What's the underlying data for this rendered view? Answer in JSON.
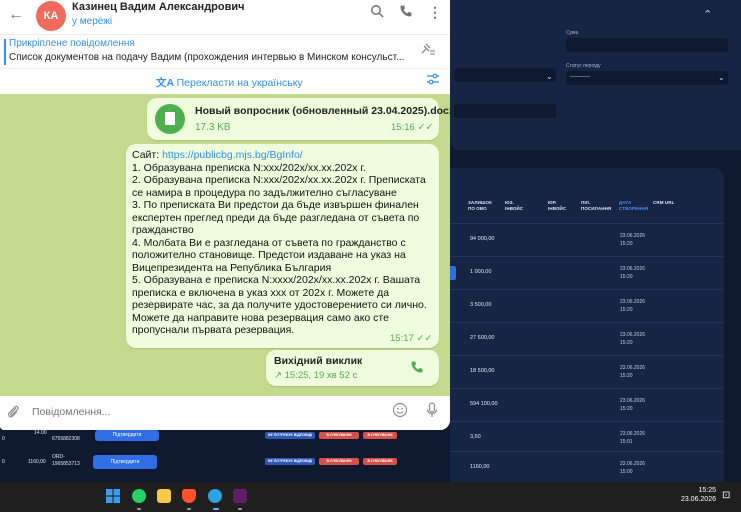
{
  "telegram": {
    "contact": {
      "initials": "КА",
      "name": "Казинец Вадим Александрович",
      "status": "у мережі"
    },
    "pinned": {
      "title": "Прикріплене повідомлення",
      "text": "Список документов на подачу Вадим (прохождения интервью в Минском консульст..."
    },
    "translate_label": "Перекласти на українську",
    "file_message": {
      "name": "Новый вопросник (обновленный 23.04.2025).docx",
      "size": "17.3 KB",
      "time": "15:16"
    },
    "text_message": {
      "link_prefix": "Сайт: ",
      "link": "https://publicbg.mjs.bg/BgInfo/",
      "lines": [
        "1. Образувана преписка N:xxx/202x/xx.xx.202x г.",
        "2. Образувана преписка N:xxx/202x/xx.xx.202x г. Преписката се намира в процедура по задължително съгласуване",
        "3. По преписката Ви предстои да бъде извършен финален експертен преглед преди да бъде разгледана от съвета по гражданство",
        "4. Молбата Ви е разгледана от съвета по гражданство с положително становище. Предстои издаване на указ на Вицепрезидента на Република България",
        "5. Образувана е преписка N:xxxx/202x/xx.xx.202x г. Вашата преписка е включена в указ xxx от 202x г. Можете да резервирате час, за да получите удостоверението си лично. Можете да направите нова резервация само ако сте пропуснали първата резервация."
      ],
      "time": "15:17"
    },
    "call_message": {
      "title": "Вихідний виклик",
      "meta": "15:25, 19 хв 52 с"
    },
    "composer_placeholder": "Повідомлення..."
  },
  "crm": {
    "filter": {
      "sum_label": "Сума",
      "status_label": "Статус періоду",
      "status_value": "----------"
    },
    "table": {
      "headers": [
        "ЗАЛИШОК ПО ОВО",
        "ЮЗ. ІНВОЙС",
        "ЮР. ІНВОЙС",
        "ПІЛ. ПОСИЛАННЯ",
        "ДАТА СТВОРЕННЯ",
        "CRM URL"
      ],
      "rows": [
        {
          "sum": "94 000,00",
          "date": "23.06.2026",
          "time": "15:20"
        },
        {
          "sum": "1 000,00",
          "date": "23.06.2026",
          "time": "15:20"
        },
        {
          "sum": "3 500,00",
          "date": "23.06.2026",
          "time": "15:20"
        },
        {
          "sum": "27 600,00",
          "date": "23.06.2026",
          "time": "15:20"
        },
        {
          "sum": "18 500,00",
          "date": "23.06.2026",
          "time": "15:20"
        },
        {
          "sum": "594 100,00",
          "date": "23.06.2026",
          "time": "15:20"
        },
        {
          "sum": "3,50",
          "date": "23.06.2026",
          "time": "15:01"
        },
        {
          "sum": "1160,00",
          "date": "23.06.2026",
          "time": "15:00"
        }
      ]
    },
    "bottom_rows": [
      {
        "left": "0",
        "amount": "14.00",
        "id": "6755882308",
        "button": "Підтвердити",
        "tag1": "НЕ ПОТРЕБУЄ ВІДПОВІДІ",
        "tag2": "В ОЧІКУВАННІ",
        "tag3": "В ОЧІКУВАННІ"
      },
      {
        "left": "0",
        "amount": "1160,00",
        "id": "ORD-1965853713",
        "button": "Підтвердити",
        "tag1": "НЕ ПОТРЕБУЄ ВІДПОВІДІ",
        "tag2": "В ОЧІКУВАННІ",
        "tag3": "В ОЧІКУВАННІ"
      }
    ]
  },
  "taskbar": {
    "time": "15:25",
    "date": "23.06.2026",
    "apps": [
      "windows-start",
      "whatsapp",
      "file-explorer",
      "brave-browser",
      "telegram",
      "slack"
    ]
  },
  "colors": {
    "telegram_accent": "#3390ec",
    "bubble_out": "#effdde",
    "chat_bg": "#c3d98d",
    "crm_bg": "#0f1a30",
    "crm_panel": "#172544",
    "crm_button": "#2f6ee5"
  }
}
